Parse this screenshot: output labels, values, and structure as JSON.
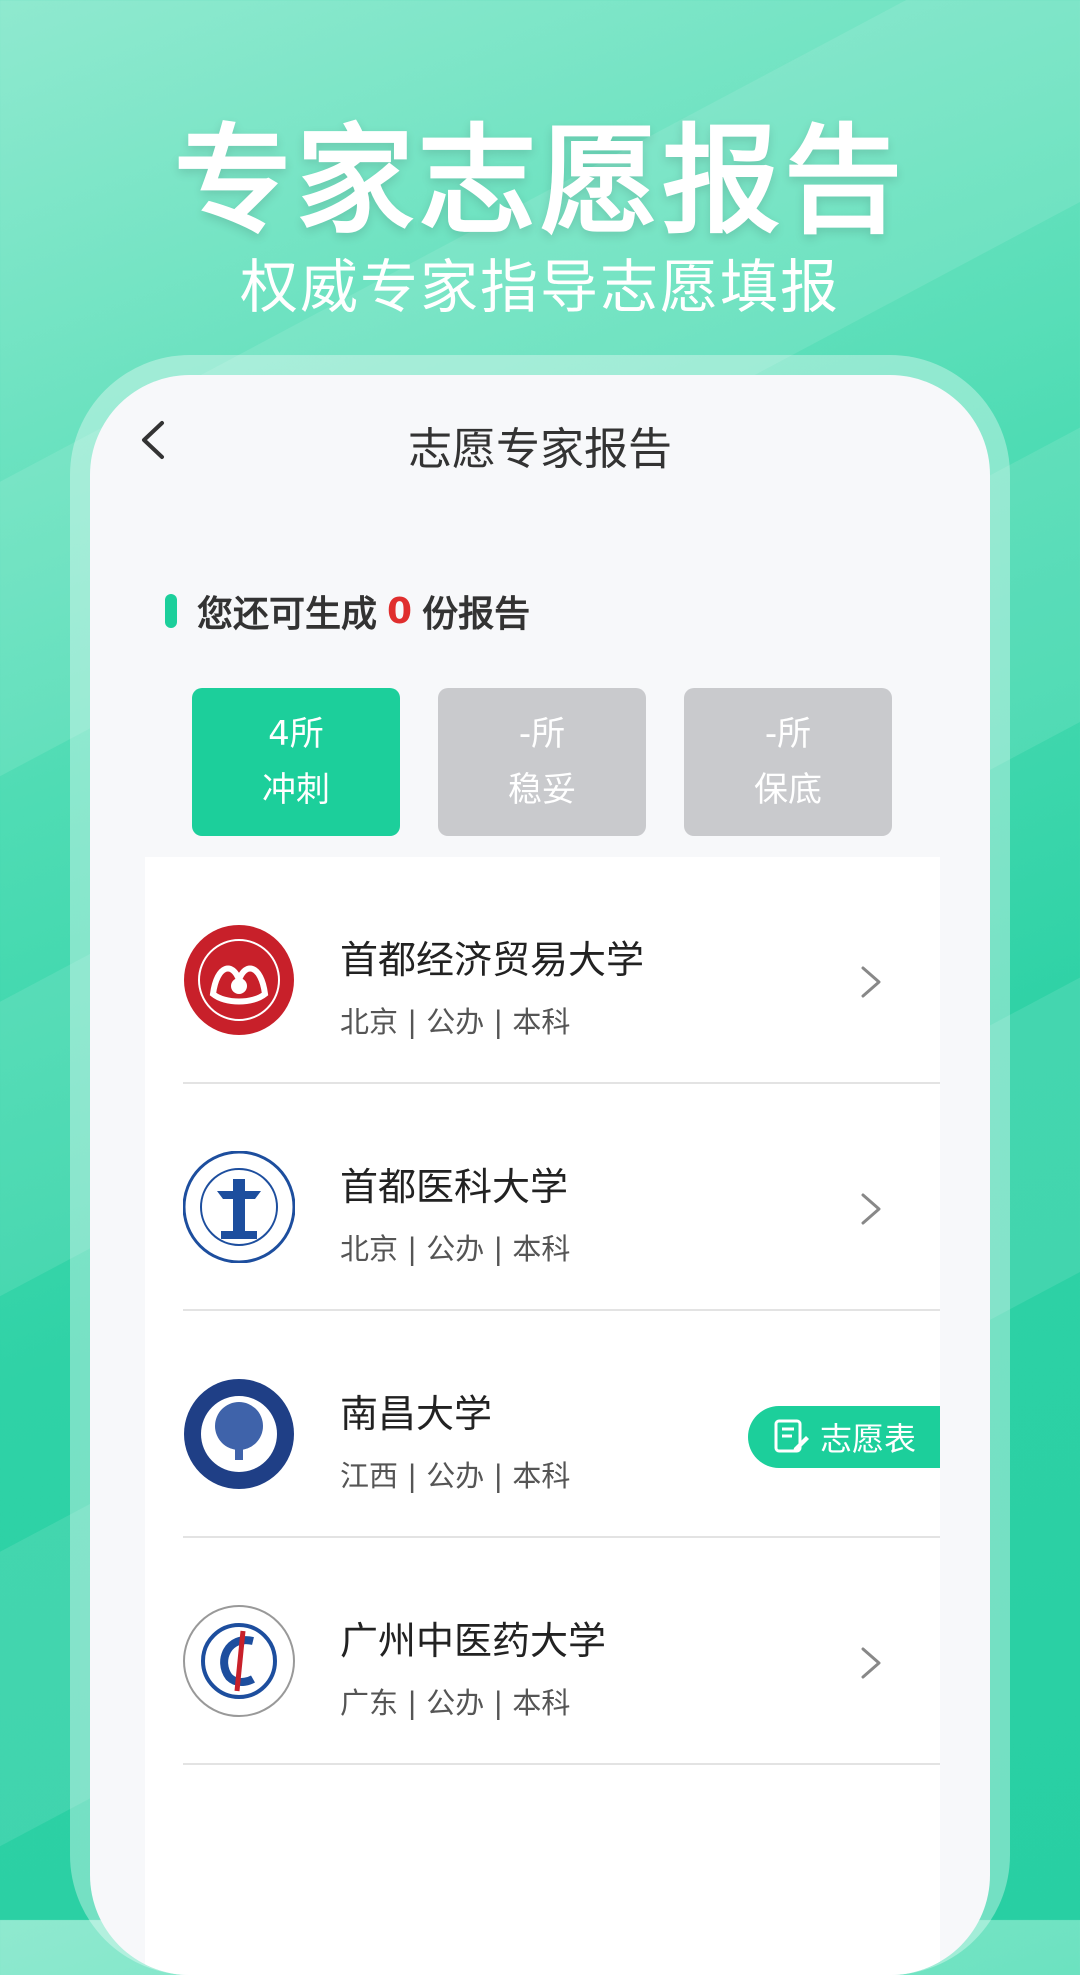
{
  "hero": {
    "title": "专家志愿报告",
    "subtitle": "权威专家指导志愿填报"
  },
  "header": {
    "title": "志愿专家报告"
  },
  "remaining": {
    "prefix": "您还可生成",
    "count": "0",
    "suffix": "份报告"
  },
  "stats": [
    {
      "value": "4所",
      "label": "冲刺"
    },
    {
      "value": "-所",
      "label": "稳妥"
    },
    {
      "value": "-所",
      "label": "保底"
    }
  ],
  "universities": [
    {
      "name": "首都经济贸易大学",
      "meta": "北京 | 公办 | 本科"
    },
    {
      "name": "首都医科大学",
      "meta": "北京 | 公办 | 本科"
    },
    {
      "name": "南昌大学",
      "meta": "江西 | 公办 | 本科",
      "badge": "志愿表"
    },
    {
      "name": "广州中医药大学",
      "meta": "广东 | 公办 | 本科"
    }
  ],
  "colors": {
    "accent": "#1ccf9b",
    "count": "#e02e2e",
    "inactive": "#c9cacd"
  }
}
